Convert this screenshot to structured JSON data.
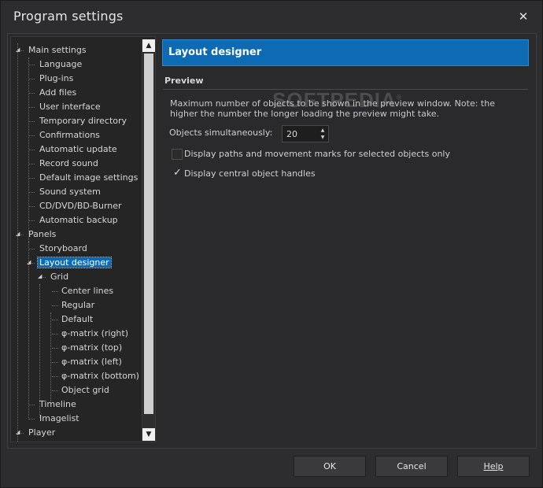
{
  "window": {
    "title": "Program settings",
    "close_glyph": "✕"
  },
  "tree": {
    "items": [
      {
        "label": "Main settings",
        "level": 0,
        "expanded": true
      },
      {
        "label": "Language",
        "level": 1
      },
      {
        "label": "Plug-ins",
        "level": 1
      },
      {
        "label": "Add files",
        "level": 1
      },
      {
        "label": "User interface",
        "level": 1
      },
      {
        "label": "Temporary directory",
        "level": 1
      },
      {
        "label": "Confirmations",
        "level": 1
      },
      {
        "label": "Automatic update",
        "level": 1
      },
      {
        "label": "Record sound",
        "level": 1
      },
      {
        "label": "Default image settings",
        "level": 1
      },
      {
        "label": "Sound system",
        "level": 1
      },
      {
        "label": "CD/DVD/BD-Burner",
        "level": 1
      },
      {
        "label": "Automatic backup",
        "level": 1
      },
      {
        "label": "Panels",
        "level": 0,
        "expanded": true
      },
      {
        "label": "Storyboard",
        "level": 1
      },
      {
        "label": "Layout designer",
        "level": 1,
        "expanded": true,
        "selected": true
      },
      {
        "label": "Grid",
        "level": 2,
        "expanded": true
      },
      {
        "label": "Center lines",
        "level": 3
      },
      {
        "label": "Regular",
        "level": 3
      },
      {
        "label": "Default",
        "level": 3
      },
      {
        "label": "φ-matrix (right)",
        "level": 3
      },
      {
        "label": "φ-matrix (top)",
        "level": 3
      },
      {
        "label": "φ-matrix (left)",
        "level": 3
      },
      {
        "label": "φ-matrix (bottom)",
        "level": 3
      },
      {
        "label": "Object grid",
        "level": 3
      },
      {
        "label": "Timeline",
        "level": 1
      },
      {
        "label": "Imagelist",
        "level": 1
      },
      {
        "label": "Player",
        "level": 0,
        "expanded": true
      }
    ]
  },
  "panel": {
    "title": "Layout designer",
    "group_title": "Preview",
    "description": "Maximum number of objects to be shown in the preview window. Note: the higher the number the longer loading the preview might take.",
    "objects_label": "Objects simultaneously:",
    "objects_value": "20",
    "option1_label": "Display paths and movement marks for selected objects only",
    "option1_checked": false,
    "option2_label": "Display central object handles",
    "option2_checked": true
  },
  "watermark": "SOFTPEDIA",
  "buttons": {
    "ok": "OK",
    "cancel": "Cancel",
    "help": "Help"
  },
  "colors": {
    "accent": "#0f6ab4",
    "background": "#2d2d30"
  }
}
